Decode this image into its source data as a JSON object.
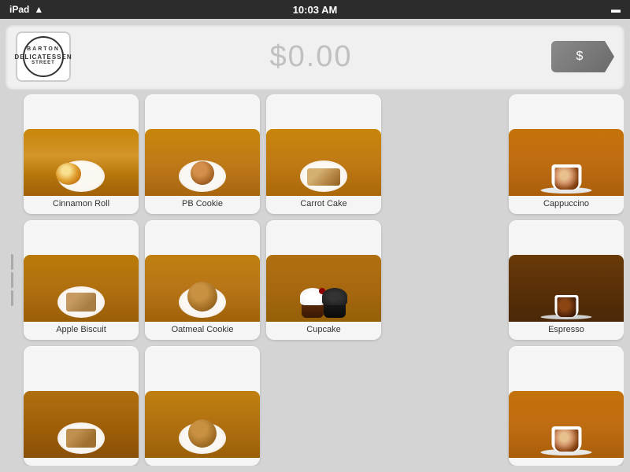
{
  "statusBar": {
    "left": "iPad",
    "wifi": "wifi",
    "time": "10:03 AM",
    "battery": "battery"
  },
  "header": {
    "logo": {
      "topText": "BARTON",
      "midText": "DELICATESSEN",
      "botText": "STREET"
    },
    "price": "$0.00",
    "chargeButton": {
      "label": "$",
      "icon": "dollar-sign-icon"
    }
  },
  "products": [
    {
      "id": "cinnamon-roll",
      "label": "Cinnamon Roll",
      "type": "baked"
    },
    {
      "id": "pb-cookie",
      "label": "PB Cookie",
      "type": "cookie"
    },
    {
      "id": "carrot-cake",
      "label": "Carrot Cake",
      "type": "cake"
    },
    {
      "id": "empty-1",
      "label": "",
      "type": "empty"
    },
    {
      "id": "cappuccino",
      "label": "Cappuccino",
      "type": "coffee-latte"
    },
    {
      "id": "apple-biscuit",
      "label": "Apple Biscuit",
      "type": "baked"
    },
    {
      "id": "oatmeal-cookie",
      "label": "Oatmeal Cookie",
      "type": "cookie"
    },
    {
      "id": "cupcake",
      "label": "Cupcake",
      "type": "cupcake"
    },
    {
      "id": "empty-2",
      "label": "",
      "type": "empty"
    },
    {
      "id": "espresso",
      "label": "Espresso",
      "type": "espresso"
    },
    {
      "id": "row3-1",
      "label": "",
      "type": "baked-partial"
    },
    {
      "id": "row3-2",
      "label": "",
      "type": "cookie-partial"
    },
    {
      "id": "empty-3",
      "label": "",
      "type": "empty"
    },
    {
      "id": "empty-4",
      "label": "",
      "type": "empty"
    },
    {
      "id": "row3-cappuccino",
      "label": "",
      "type": "coffee-latte-partial"
    }
  ],
  "colors": {
    "background": "#d4d4d4",
    "header_bg": "#f0f0f0",
    "item_bg": "#f5f5f5",
    "price_color": "#c0c0c0",
    "charge_btn": "#757575"
  }
}
